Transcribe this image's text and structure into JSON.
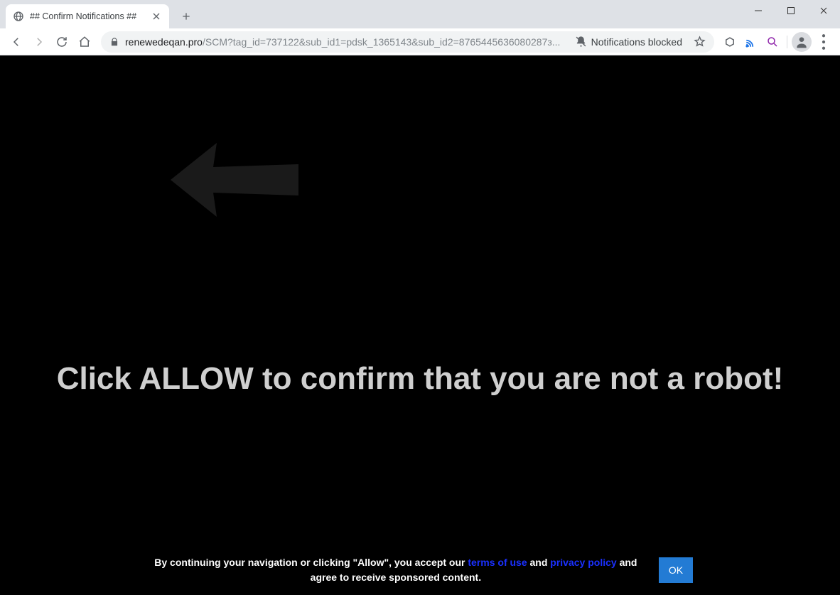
{
  "window": {
    "tab_title": "## Confirm Notifications ##"
  },
  "toolbar": {
    "url_domain": "renewedeqan.pro",
    "url_path": "/SCM?tag_id=737122&sub_id1=pdsk_1365143&sub_id2=8765445636080287з...",
    "notifications_blocked_label": "Notifications blocked"
  },
  "page": {
    "headline": "Click ALLOW to confirm that you are not a robot!",
    "cookie_prefix": "By continuing your navigation or clicking \"Allow\", you accept our ",
    "terms_link": "terms of use",
    "cookie_and": " and ",
    "privacy_link": "privacy policy",
    "cookie_suffix": " and agree to receive sponsored content.",
    "ok_label": "OK"
  }
}
